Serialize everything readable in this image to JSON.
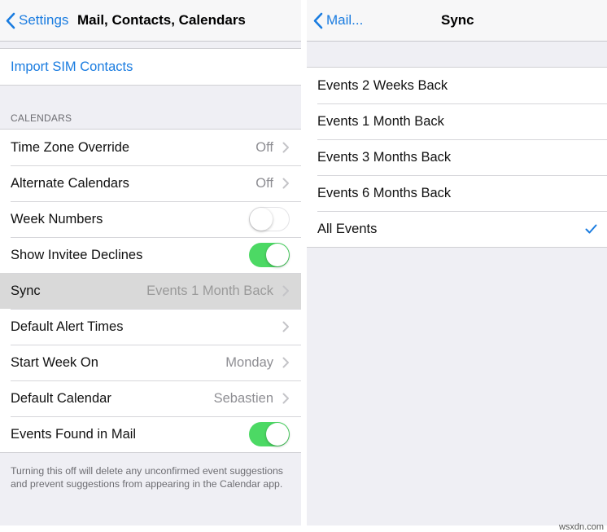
{
  "left": {
    "nav": {
      "back_label": "Settings",
      "title": "Mail, Contacts, Calendars"
    },
    "import_label": "Import SIM Contacts",
    "section_header": "CALENDARS",
    "rows": [
      {
        "label": "Time Zone Override",
        "value": "Off"
      },
      {
        "label": "Alternate Calendars",
        "value": "Off"
      },
      {
        "label": "Week Numbers",
        "toggle": "off"
      },
      {
        "label": "Show Invitee Declines",
        "toggle": "on"
      },
      {
        "label": "Sync",
        "value": "Events 1 Month Back"
      },
      {
        "label": "Default Alert Times",
        "value": ""
      },
      {
        "label": "Start Week On",
        "value": "Monday"
      },
      {
        "label": "Default Calendar",
        "value": "Sebastien"
      },
      {
        "label": "Events Found in Mail",
        "toggle": "on"
      }
    ],
    "footer": "Turning this off will delete any unconfirmed event suggestions and prevent suggestions from appearing in the Calendar app."
  },
  "right": {
    "nav": {
      "back_label": "Mail...",
      "title": "Sync"
    },
    "options": [
      "Events 2 Weeks Back",
      "Events 1 Month Back",
      "Events 3 Months Back",
      "Events 6 Months Back",
      "All Events"
    ],
    "selected_option": "All Events"
  },
  "watermark": "wsxdn.com",
  "colors": {
    "accent": "#1a7ce0",
    "toggle_on": "#4cd964"
  },
  "icons": {
    "back": "chevron-left-icon",
    "disclosure": "chevron-right-icon",
    "check": "checkmark-icon"
  }
}
